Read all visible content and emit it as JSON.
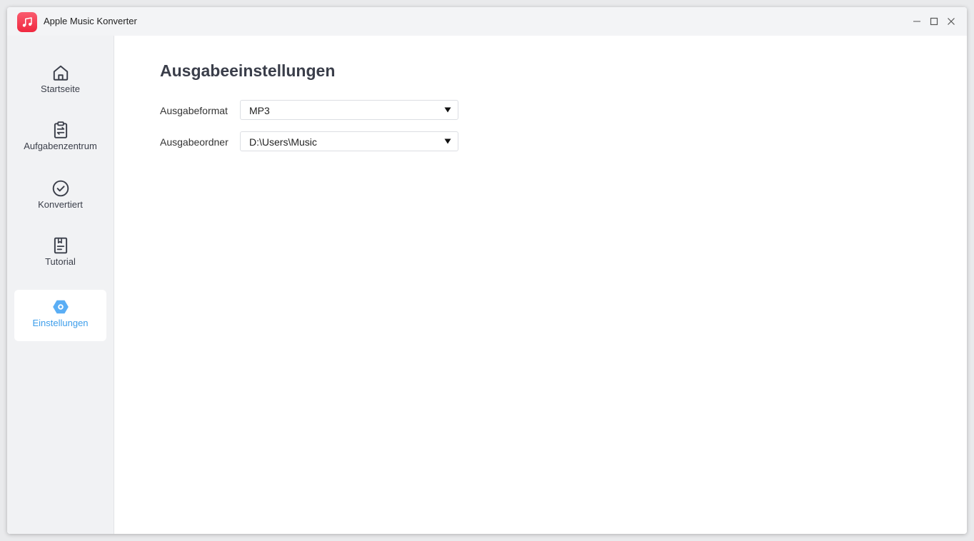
{
  "window": {
    "title": "Apple Music Konverter",
    "app_icon": "music-note-icon",
    "controls": [
      "minimize-icon",
      "maximize-icon",
      "close-icon"
    ]
  },
  "sidebar": {
    "items": [
      {
        "label": "Startseite",
        "icon": "home-icon",
        "active": false
      },
      {
        "label": "Aufgabenzentrum",
        "icon": "clipboard-icon",
        "active": false
      },
      {
        "label": "Konvertiert",
        "icon": "check-circle-icon",
        "active": false
      },
      {
        "label": "Tutorial",
        "icon": "book-icon",
        "active": false
      },
      {
        "label": "Einstellungen",
        "icon": "gear-icon",
        "active": true
      }
    ]
  },
  "main": {
    "title": "Ausgabeeinstellungen",
    "format": {
      "label": "Ausgabeformat",
      "value": "MP3"
    },
    "folder": {
      "label": "Ausgabeordner",
      "value": "D:\\Users\\Music"
    }
  },
  "colors": {
    "accent": "#3d9eeb",
    "app_icon": "#f0283f",
    "sidebar_bg": "#f1f2f4",
    "titlebar_bg": "#f3f4f6"
  }
}
